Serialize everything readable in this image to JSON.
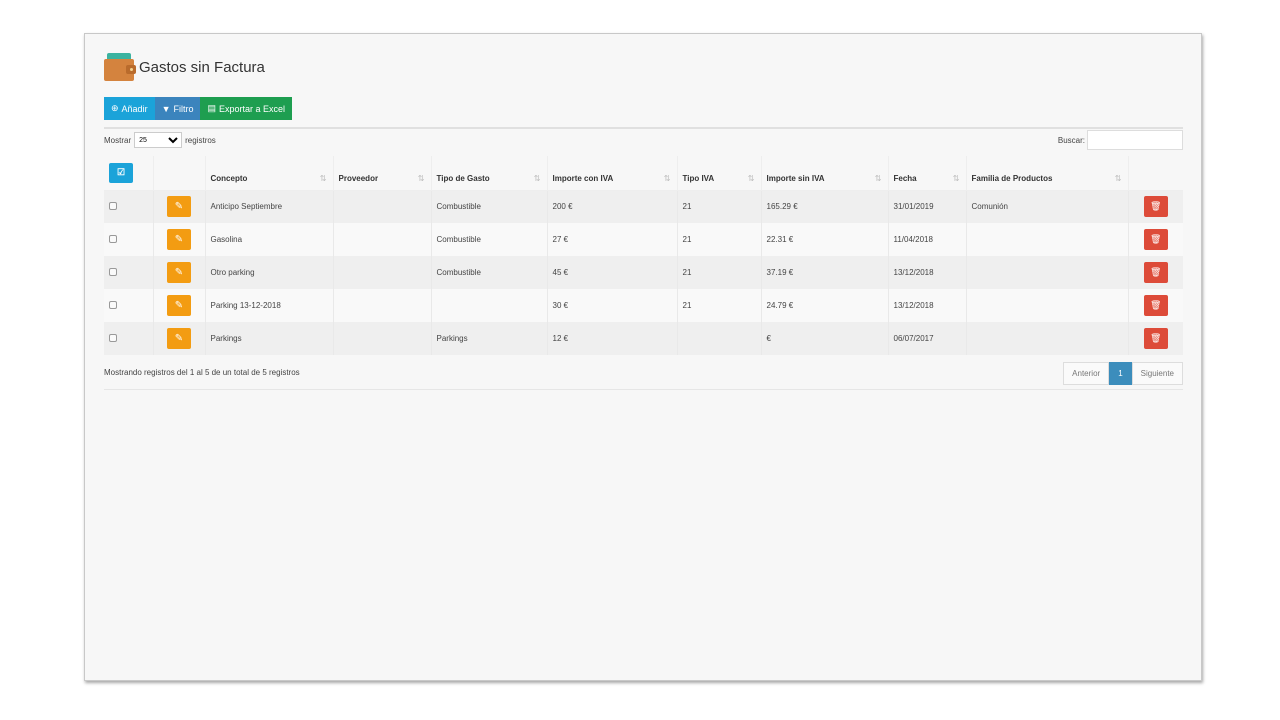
{
  "page": {
    "title": "Gastos sin Factura"
  },
  "toolbar": {
    "add_label": "Añadir",
    "filter_label": "Filtro",
    "excel_label": "Exportar a Excel"
  },
  "length": {
    "prefix": "Mostrar",
    "value": "25",
    "suffix": "registros"
  },
  "search": {
    "label": "Buscar:",
    "value": ""
  },
  "table": {
    "headers": [
      "Concepto",
      "Proveedor",
      "Tipo de Gasto",
      "Importe con IVA",
      "Tipo IVA",
      "Importe sin IVA",
      "Fecha",
      "Familia de Productos"
    ],
    "rows": [
      {
        "concepto": "Anticipo Septiembre",
        "proveedor": "",
        "tipo": "Combustible",
        "con_iva": "200 €",
        "tipo_iva": "21",
        "sin_iva": "165.29 €",
        "fecha": "31/01/2019",
        "familia": "Comunión"
      },
      {
        "concepto": "Gasolina",
        "proveedor": "",
        "tipo": "Combustible",
        "con_iva": "27 €",
        "tipo_iva": "21",
        "sin_iva": "22.31 €",
        "fecha": "11/04/2018",
        "familia": ""
      },
      {
        "concepto": "Otro parking",
        "proveedor": "",
        "tipo": "Combustible",
        "con_iva": "45 €",
        "tipo_iva": "21",
        "sin_iva": "37.19 €",
        "fecha": "13/12/2018",
        "familia": ""
      },
      {
        "concepto": "Parking 13-12-2018",
        "proveedor": "",
        "tipo": "",
        "con_iva": "30 €",
        "tipo_iva": "21",
        "sin_iva": "24.79 €",
        "fecha": "13/12/2018",
        "familia": ""
      },
      {
        "concepto": "Parkings",
        "proveedor": "",
        "tipo": "Parkings",
        "con_iva": "12 €",
        "tipo_iva": "",
        "sin_iva": "€",
        "fecha": "06/07/2017",
        "familia": ""
      }
    ]
  },
  "footer": {
    "info": "Mostrando registros del 1 al 5 de un total de 5 registros"
  },
  "pagination": {
    "prev": "Anterior",
    "current": "1",
    "next": "Siguiente"
  }
}
